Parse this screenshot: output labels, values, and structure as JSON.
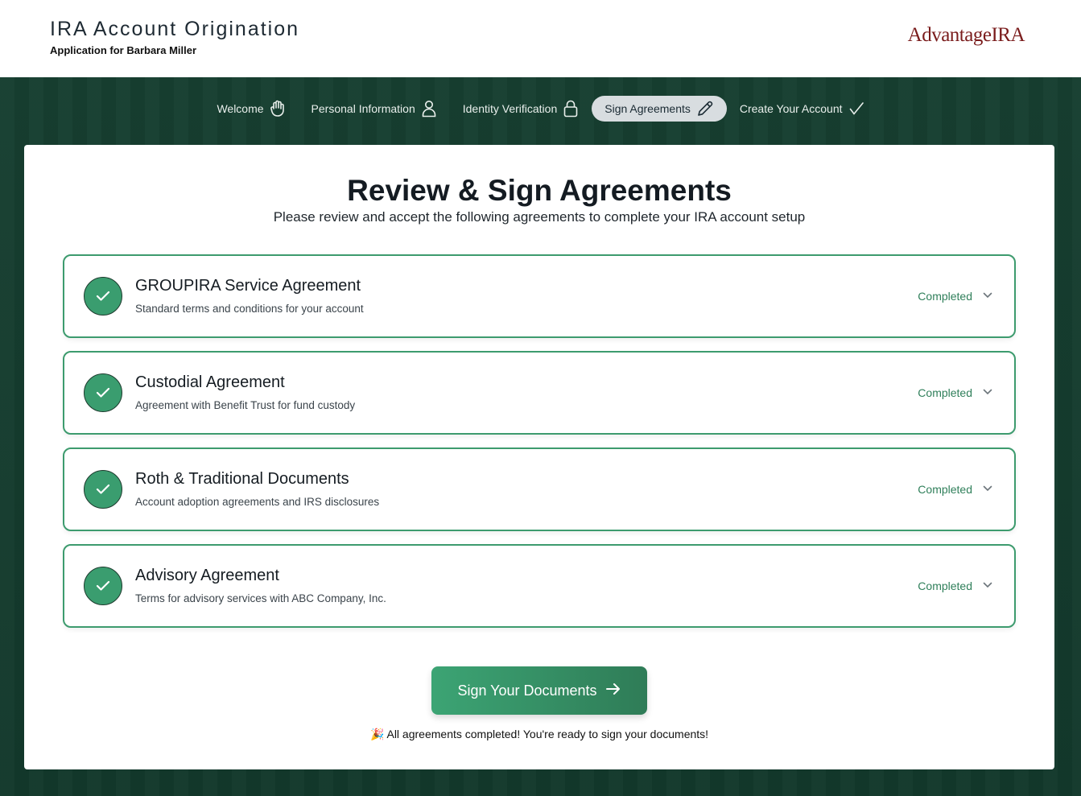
{
  "header": {
    "title": "IRA Account Origination",
    "subtitle": "Application for Barbara Miller",
    "brand": "AdvantageIRA"
  },
  "steps": [
    {
      "label": "Welcome",
      "icon": "hand-icon",
      "active": false
    },
    {
      "label": "Personal Information",
      "icon": "person-icon",
      "active": false
    },
    {
      "label": "Identity Verification",
      "icon": "lock-icon",
      "active": false
    },
    {
      "label": "Sign Agreements",
      "icon": "pencil-icon",
      "active": true
    },
    {
      "label": "Create Your Account",
      "icon": "checkmark-icon",
      "active": false
    }
  ],
  "main": {
    "title": "Review & Sign Agreements",
    "subtitle": "Please review and accept the following agreements to complete your IRA account setup",
    "agreements": [
      {
        "title": "GROUPIRA Service Agreement",
        "description": "Standard terms and conditions for your account",
        "status": "Completed"
      },
      {
        "title": "Custodial Agreement",
        "description": "Agreement with Benefit Trust for fund custody",
        "status": "Completed"
      },
      {
        "title": "Roth & Traditional Documents",
        "description": "Account adoption agreements and IRS disclosures",
        "status": "Completed"
      },
      {
        "title": "Advisory Agreement",
        "description": "Terms for advisory services with ABC Company, Inc.",
        "status": "Completed"
      }
    ],
    "sign_button": "Sign Your Documents",
    "completion_message": "🎉 All agreements completed! You're ready to sign your documents!"
  },
  "colors": {
    "background": "#173d30",
    "accent": "#3a9d6f",
    "brand": "#7a1c1c",
    "status": "#2f7f5a"
  }
}
